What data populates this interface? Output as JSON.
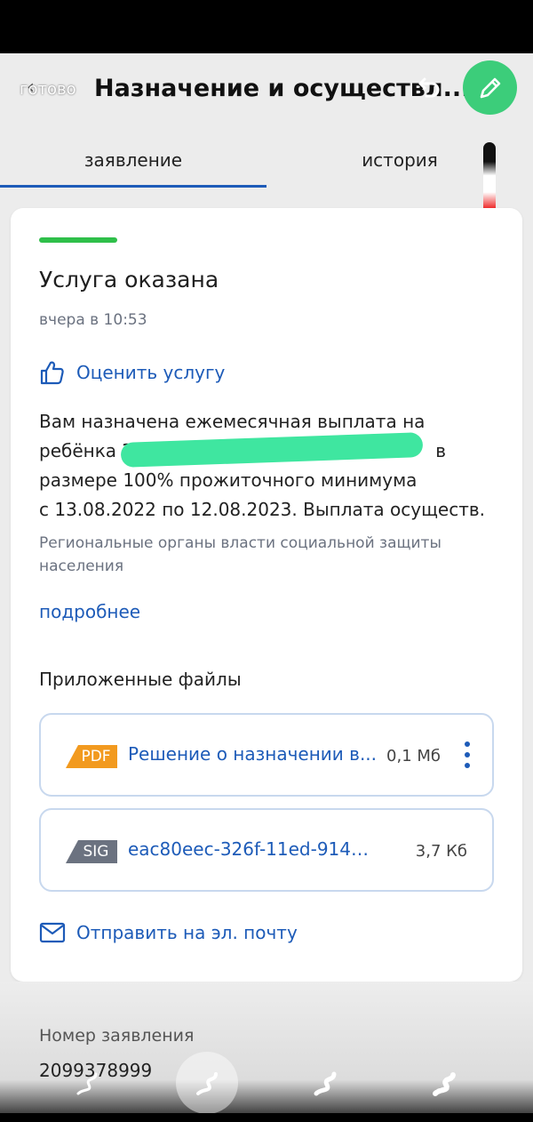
{
  "header": {
    "done_label": "готово",
    "title": "Назначение и осуществл..."
  },
  "tabs": [
    {
      "label": "заявление",
      "active": true
    },
    {
      "label": "история",
      "active": false
    }
  ],
  "status": {
    "title": "Услуга оказана",
    "time": "вчера в 10:53",
    "color": "#2fbf4a"
  },
  "rate_link": "Оценить услугу",
  "message": {
    "line1": "Вам назначена ежемесячная выплата на",
    "line2_start": "ребёнка З",
    "line2_end": "в",
    "line3": "размере 100% прожиточного минимума",
    "line4": "с 13.08.2022 по 12.08.2023. Выплата осуществ..."
  },
  "authority": "Региональные органы власти социальной защиты населения",
  "more_link": "подробнее",
  "files": {
    "heading": "Приложенные файлы",
    "items": [
      {
        "badge": "PDF",
        "name": "Решение о назначении в...",
        "size": "0,1 Мб"
      },
      {
        "badge": "SIG",
        "name": "eac80eec-326f-11ed-9142-d...",
        "size": "3,7 Кб"
      }
    ]
  },
  "email_link": "Отправить на эл. почту",
  "application": {
    "label": "Номер заявления",
    "number": "2099378999"
  },
  "colors": {
    "accent": "#1d5bb8",
    "edit_button": "#3ccd7a",
    "redaction": "#3fe6a0",
    "pdf_badge": "#f29a1f",
    "sig_badge": "#6b7280"
  }
}
